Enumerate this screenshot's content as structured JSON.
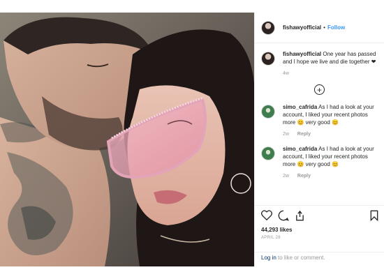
{
  "post": {
    "username": "fishawyofficial",
    "separator": "•",
    "follow_label": "Follow",
    "caption": "One year has passed and I hope we live and die together ❤",
    "caption_time": "4w",
    "comments": [
      {
        "username": "simo_cafrida",
        "text": "As I had a look at your account, I liked your recent photos more 😊 very good 😊",
        "time": "2w",
        "reply_label": "Reply"
      },
      {
        "username": "simo_cafrida",
        "text": "As I had a look at your account, I liked your recent photos more 😊 very good 😊",
        "time": "2w",
        "reply_label": "Reply"
      }
    ],
    "load_more_icon": "plus-circle-icon",
    "likes": "44,293 likes",
    "date": "APRIL 28",
    "login_link": "Log in",
    "login_text": " to like or comment."
  },
  "icons": [
    "heart-icon",
    "comment-icon",
    "share-icon",
    "bookmark-icon"
  ],
  "colors": {
    "accent": "#3897f0",
    "link": "#003569",
    "muted": "#999999"
  }
}
